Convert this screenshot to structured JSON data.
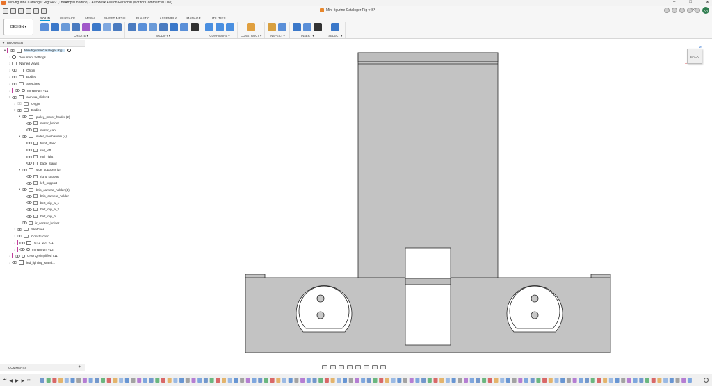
{
  "window": {
    "title": "Mini-figurine Cataloger Rig v46* (TheAmplituhedron) - Autodesk Fusion Personal (Not for Commercial Use)",
    "controls": [
      "–",
      "□",
      "✕"
    ]
  },
  "doc_tab": {
    "label": "Mini-figurine Cataloger Rig v46*"
  },
  "user": {
    "initials": "KA"
  },
  "ribbon": {
    "workspace": "DESIGN ▾",
    "tabs": [
      "SOLID",
      "SURFACE",
      "MESH",
      "SHEET METAL",
      "PLASTIC",
      "ASSEMBLY",
      "MANAGE",
      "UTILITIES"
    ],
    "active_tab": "SOLID",
    "groups": [
      {
        "label": "CREATE ▾",
        "icons": [
          "new-component",
          "extrude",
          "revolve",
          "sweep",
          "loft",
          "rib",
          "pattern",
          "mirror"
        ],
        "colors": [
          "#5a8fd8",
          "#3b78c9",
          "#6a9ad8",
          "#4a7bc0",
          "#a158c9",
          "#3b78c9",
          "#7fa8e0",
          "#4a7bc0"
        ]
      },
      {
        "label": "MODIFY ▾",
        "icons": [
          "press-pull",
          "fillet",
          "chamfer",
          "shell",
          "combine",
          "offset",
          "move"
        ],
        "colors": [
          "#4a7bc0",
          "#5a8fd8",
          "#6a9ad8",
          "#4a7bc0",
          "#3b78c9",
          "#5a8fd8",
          "#333333"
        ]
      },
      {
        "label": "CONFIGURE ▾",
        "icons": [
          "config-1",
          "config-2",
          "config-3"
        ],
        "colors": [
          "#4a8fe0",
          "#4a8fe0",
          "#4a8fe0"
        ]
      },
      {
        "label": "CONSTRUCT ▾",
        "icons": [
          "plane"
        ],
        "colors": [
          "#e0a040"
        ]
      },
      {
        "label": "INSPECT ▾",
        "icons": [
          "measure",
          "interference"
        ],
        "colors": [
          "#d8a040",
          "#5a8fd8"
        ]
      },
      {
        "label": "INSERT ▾",
        "icons": [
          "insert-derive",
          "insert-image",
          "insert-mesh"
        ],
        "colors": [
          "#3b78c9",
          "#5a8fd8",
          "#333333"
        ]
      },
      {
        "label": "SELECT ▾",
        "icons": [
          "select-window"
        ],
        "colors": [
          "#3b78c9"
        ]
      }
    ]
  },
  "browser": {
    "title": "BROWSER",
    "items": [
      {
        "label": "Mini-figurine Cataloger Rig...",
        "depth": 0,
        "arrow": "▾",
        "icon": "doc",
        "selected": true,
        "radio": true,
        "tag": "#c23d9b"
      },
      {
        "label": "Document Settings",
        "depth": 1,
        "arrow": "›",
        "icon": "gear"
      },
      {
        "label": "Named Views",
        "depth": 1,
        "arrow": "›",
        "icon": "folder"
      },
      {
        "label": "Origin",
        "depth": 1,
        "arrow": "›",
        "icon": "folder",
        "eye": true
      },
      {
        "label": "Bodies",
        "depth": 1,
        "arrow": "›",
        "icon": "folder",
        "eye": true
      },
      {
        "label": "Sketches",
        "depth": 1,
        "arrow": "›",
        "icon": "folder",
        "eye": true
      },
      {
        "label": "mmgm-pm v11",
        "depth": 1,
        "arrow": "›",
        "icon": "link",
        "eye": true,
        "tag": "#c23d9b"
      },
      {
        "label": "camera_slider:1",
        "depth": 1,
        "arrow": "▾",
        "icon": "comp",
        "eye": true
      },
      {
        "label": "Origin",
        "depth": 2,
        "arrow": "›",
        "icon": "folder",
        "eye": true,
        "off": true
      },
      {
        "label": "Bodies",
        "depth": 2,
        "arrow": "▾",
        "icon": "folder",
        "eye": true
      },
      {
        "label": "pulley_motor_holder (2)",
        "depth": 3,
        "arrow": "▾",
        "icon": "folder",
        "eye": true
      },
      {
        "label": "motor_holder",
        "depth": 4,
        "arrow": "",
        "icon": "body",
        "eye": true
      },
      {
        "label": "motor_cap",
        "depth": 4,
        "arrow": "",
        "icon": "body",
        "eye": true
      },
      {
        "label": "slider_mechanism (4)",
        "depth": 3,
        "arrow": "▾",
        "icon": "folder",
        "eye": true
      },
      {
        "label": "front_stand",
        "depth": 4,
        "arrow": "",
        "icon": "body",
        "eye": true
      },
      {
        "label": "rod_left",
        "depth": 4,
        "arrow": "",
        "icon": "body",
        "eye": true
      },
      {
        "label": "rod_right",
        "depth": 4,
        "arrow": "",
        "icon": "body",
        "eye": true
      },
      {
        "label": "back_stand",
        "depth": 4,
        "arrow": "",
        "icon": "body",
        "eye": true
      },
      {
        "label": "side_supports (2)",
        "depth": 3,
        "arrow": "▾",
        "icon": "folder",
        "eye": true
      },
      {
        "label": "right_support",
        "depth": 4,
        "arrow": "",
        "icon": "body",
        "eye": true
      },
      {
        "label": "left_support",
        "depth": 4,
        "arrow": "",
        "icon": "body",
        "eye": true
      },
      {
        "label": "brio_camera_holder (4)",
        "depth": 3,
        "arrow": "▾",
        "icon": "folder",
        "eye": true
      },
      {
        "label": "brio_camera_holder",
        "depth": 4,
        "arrow": "",
        "icon": "body",
        "eye": true
      },
      {
        "label": "belt_clip_a_1",
        "depth": 4,
        "arrow": "",
        "icon": "body",
        "eye": true
      },
      {
        "label": "belt_clip_a_2",
        "depth": 4,
        "arrow": "",
        "icon": "body",
        "eye": true
      },
      {
        "label": "belt_clip_b",
        "depth": 4,
        "arrow": "",
        "icon": "body",
        "eye": true
      },
      {
        "label": "ir_sensor_holder",
        "depth": 3,
        "arrow": "",
        "icon": "body",
        "eye": true
      },
      {
        "label": "Sketches",
        "depth": 2,
        "arrow": "›",
        "icon": "folder",
        "eye": true
      },
      {
        "label": "Construction",
        "depth": 2,
        "arrow": "›",
        "icon": "folder",
        "eye": true
      },
      {
        "label": "GT2_20T v11",
        "depth": 2,
        "arrow": "›",
        "icon": "comp",
        "eye": true,
        "tag": "#c23d9b"
      },
      {
        "label": "mmgm-pm v12",
        "depth": 2,
        "arrow": "›",
        "icon": "link",
        "eye": true,
        "tag": "#c23d9b"
      },
      {
        "label": "UNO Q simplified v11",
        "depth": 1,
        "arrow": "›",
        "icon": "link",
        "eye": true,
        "tag": "#c23d9b"
      },
      {
        "label": "led_lighting_stand:1",
        "depth": 1,
        "arrow": "›",
        "icon": "comp",
        "eye": true
      }
    ]
  },
  "viewcube": {
    "face": "BACK",
    "axis_z": "Z",
    "axis_x": "X"
  },
  "comments": {
    "title": "COMMENTS",
    "add": "+"
  },
  "timeline": {
    "controls": [
      "⏮",
      "◀",
      "▶",
      "▶",
      "⏭"
    ]
  },
  "colors": {
    "model_fill": "#c3c3c3",
    "model_stroke": "#2a2a2a",
    "accent": "#0696d7"
  }
}
